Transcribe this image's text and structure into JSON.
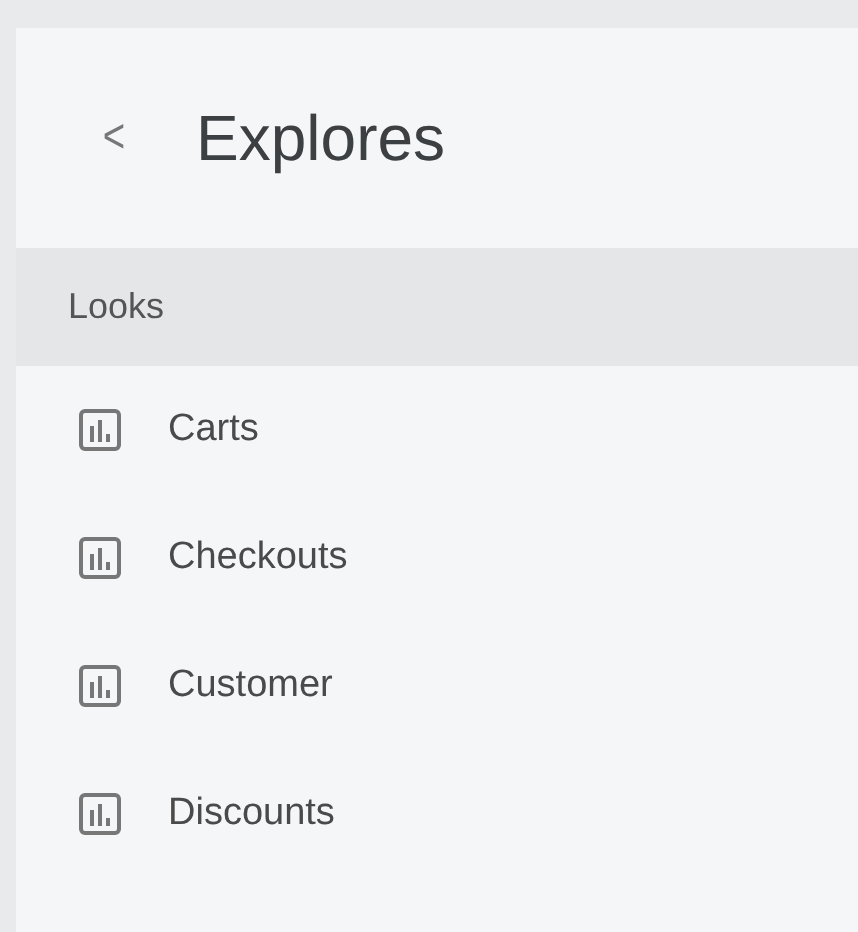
{
  "header": {
    "back": "<",
    "title": "Explores"
  },
  "section": {
    "label": "Looks"
  },
  "items": [
    {
      "label": "Carts"
    },
    {
      "label": "Checkouts"
    },
    {
      "label": "Customer"
    },
    {
      "label": "Discounts"
    }
  ]
}
